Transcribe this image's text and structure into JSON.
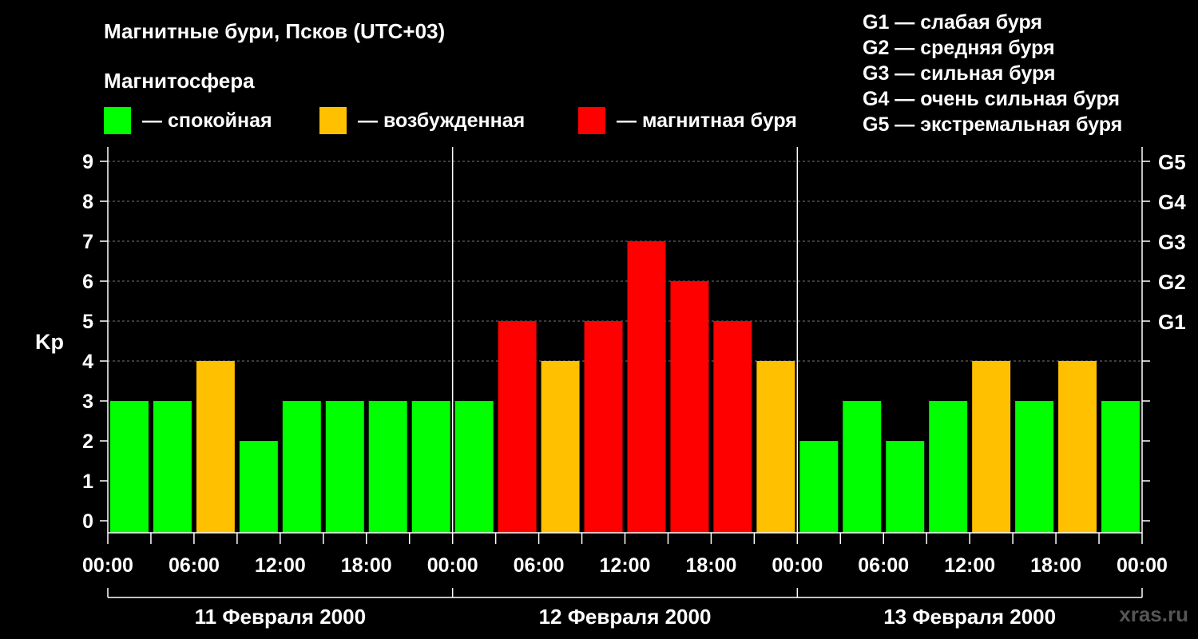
{
  "title": "Магнитные бури, Псков (UTC+03)",
  "subtitle": "Магнитосфера",
  "legend": [
    {
      "label": "— спокойная",
      "color": "#00ff00"
    },
    {
      "label": "— возбужденная",
      "color": "#ffc000"
    },
    {
      "label": "— магнитная буря",
      "color": "#ff0000"
    }
  ],
  "g_scale": [
    "G1 — слабая буря",
    "G2 — средняя буря",
    "G3 — сильная буря",
    "G4 — очень сильная буря",
    "G5 — экстремальная буря"
  ],
  "watermark": "xras.ru",
  "chart_data": {
    "type": "bar",
    "ylabel": "Kp",
    "ylim": [
      0,
      9
    ],
    "y_ticks": [
      "0",
      "1",
      "2",
      "3",
      "4",
      "5",
      "6",
      "7",
      "8",
      "9"
    ],
    "right_ticks": [
      {
        "value": 5,
        "label": "G1"
      },
      {
        "value": 6,
        "label": "G2"
      },
      {
        "value": 7,
        "label": "G3"
      },
      {
        "value": 8,
        "label": "G4"
      },
      {
        "value": 9,
        "label": "G5"
      }
    ],
    "x_tick_labels": [
      "00:00",
      "06:00",
      "12:00",
      "18:00",
      "00:00",
      "06:00",
      "12:00",
      "18:00",
      "00:00",
      "06:00",
      "12:00",
      "18:00",
      "00:00"
    ],
    "days": [
      "11 Февраля 2000",
      "12 Февраля 2000",
      "13 Февраля 2000"
    ],
    "level_colors": {
      "quiet": "#00ff00",
      "active": "#ffc000",
      "storm": "#ff0000"
    },
    "values": [
      3,
      3,
      4,
      2,
      3,
      3,
      3,
      3,
      3,
      5,
      4,
      5,
      7,
      6,
      5,
      4,
      2,
      3,
      2,
      3,
      4,
      3,
      4,
      3
    ],
    "grid": true
  }
}
